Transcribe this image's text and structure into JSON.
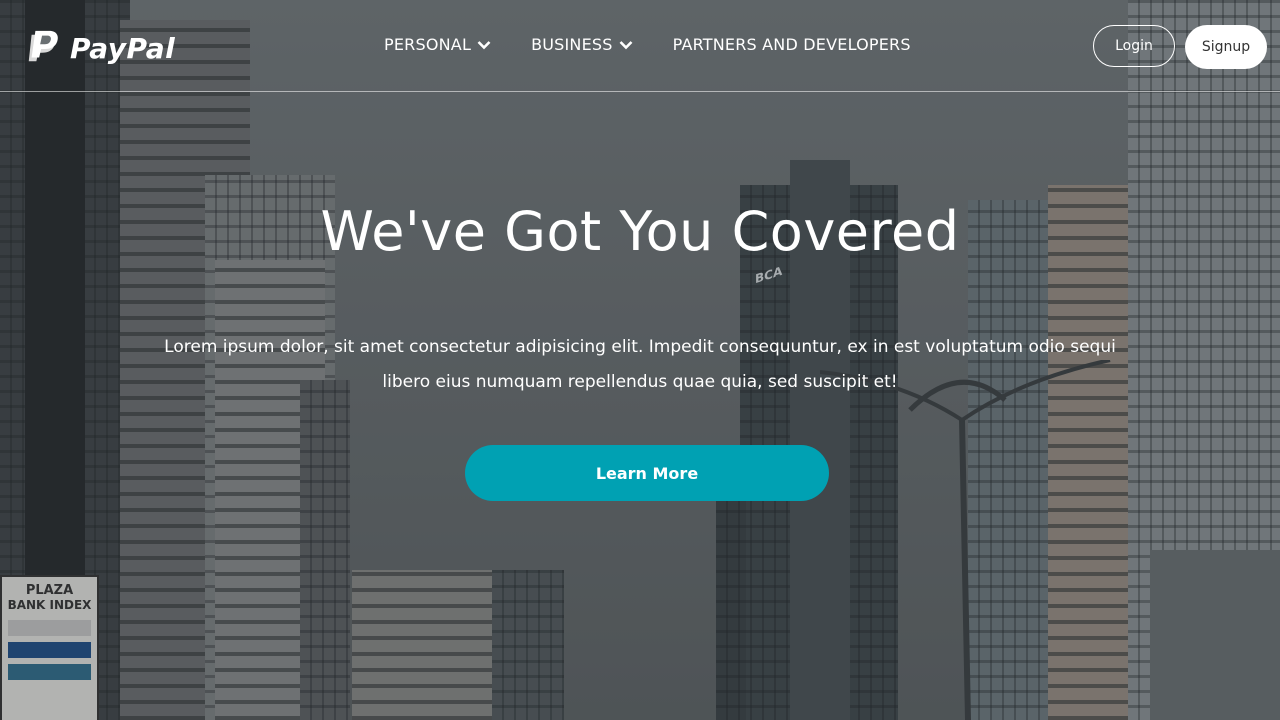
{
  "brand": {
    "name": "PayPal",
    "accent_color": "#00a1b3",
    "top_bar_color": "#7f5ad6"
  },
  "nav": {
    "items": [
      {
        "label": "PERSONAL",
        "has_dropdown": true
      },
      {
        "label": "BUSINESS",
        "has_dropdown": true
      },
      {
        "label": "PARTNERS AND DEVELOPERS",
        "has_dropdown": false
      }
    ],
    "login_label": "Login",
    "signup_label": "Signup"
  },
  "hero": {
    "title": "We've Got You Covered",
    "text": "Lorem ipsum dolor, sit amet consectetur adipisicing elit. Impedit consequuntur, ex in est voluptatum odio sequi libero eius numquam repellendus quae quia, sed suscipit et!",
    "button_label": "Learn More"
  },
  "background": {
    "sign_lines": [
      "PLAZA",
      "BANK INDEX"
    ],
    "tower_sign": "BCA"
  }
}
